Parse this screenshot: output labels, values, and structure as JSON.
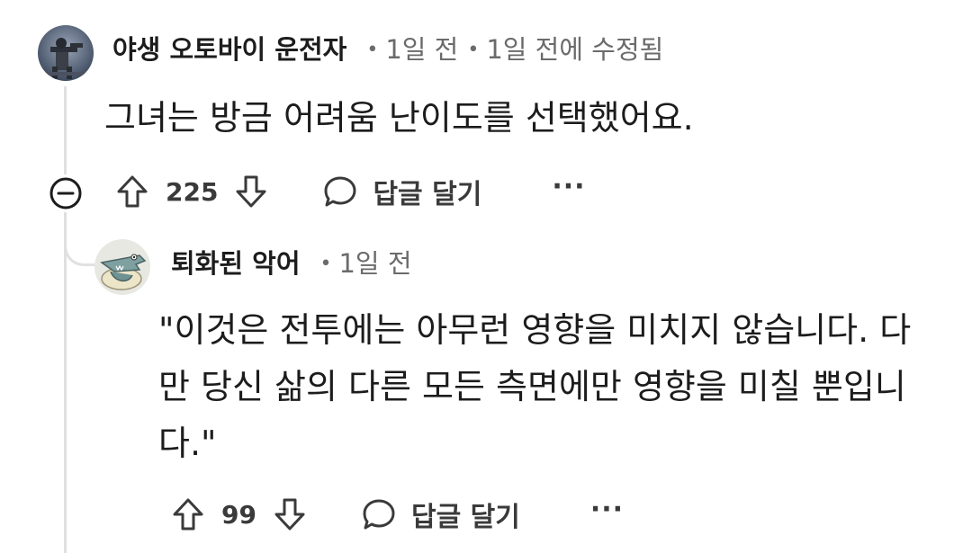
{
  "comment": {
    "author": "야생 오토바이 운전자",
    "separator": "•",
    "time": "1일 전",
    "edited_time": "1일 전",
    "edited_suffix": "에 수정됨",
    "body": "그녀는 방금 어려움 난이도를 선택했어요.",
    "score": "225",
    "reply_label": "답글 달기",
    "more_label": "···",
    "avatar_icon": "soldier-avatar-icon"
  },
  "reply": {
    "author": "퇴화된 악어",
    "separator": "•",
    "time": "1일 전",
    "body": "\"이것은 전투에는 아무런 영향을 미치지 않습니다. 다만 당신 삶의 다른 모든 측면에만 영향을 미칠 뿐입니다.\"",
    "score": "99",
    "reply_label": "답글 달기",
    "more_label": "···",
    "avatar_icon": "crocodile-avatar-icon"
  },
  "colors": {
    "text": "#1c1c1c",
    "meta": "#6b6b6b",
    "thread_line": "#e0e0e0"
  }
}
